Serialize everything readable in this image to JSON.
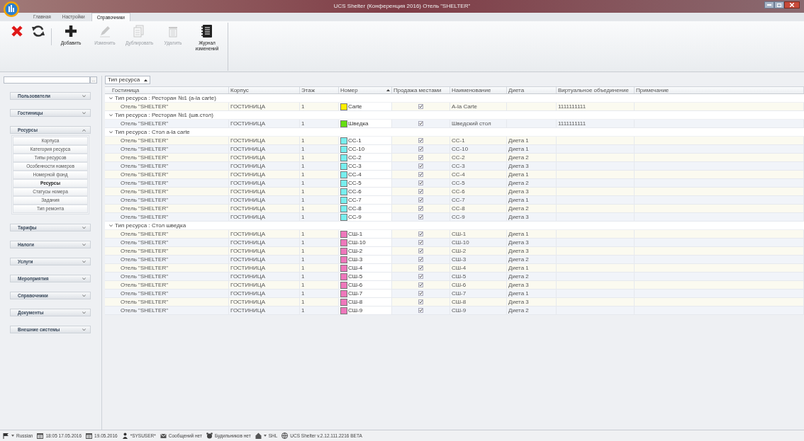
{
  "window": {
    "title": "UCS Shelter (Конференция 2016) Отель \"SHELTER\""
  },
  "tabs": [
    {
      "label": "Главная",
      "selected": false
    },
    {
      "label": "Настройки",
      "selected": false
    },
    {
      "label": "Справочники",
      "selected": true
    }
  ],
  "toolbar": [
    {
      "kind": "close",
      "disabled": false
    },
    {
      "kind": "refresh",
      "disabled": false
    },
    {
      "kind": "add",
      "label": "Добавить",
      "disabled": false
    },
    {
      "kind": "edit",
      "label": "Изменить",
      "disabled": true
    },
    {
      "kind": "duplicate",
      "label": "Дублировать",
      "disabled": true
    },
    {
      "kind": "delete",
      "label": "Удалить",
      "disabled": true
    },
    {
      "kind": "journal",
      "label": "Журнал изменений",
      "disabled": false
    }
  ],
  "sidebar": {
    "search_button": "...",
    "sections": [
      {
        "label": "Пользователи",
        "expanded": false
      },
      {
        "label": "Гостиницы",
        "expanded": false
      },
      {
        "label": "Ресурсы",
        "expanded": true,
        "items": [
          {
            "label": "Корпуса",
            "selected": false
          },
          {
            "label": "Категория ресурса",
            "selected": false
          },
          {
            "label": "Типы ресурсов",
            "selected": false
          },
          {
            "label": "Особенности номеров",
            "selected": false
          },
          {
            "label": "Номерной фонд",
            "selected": false
          },
          {
            "label": "Ресурсы",
            "selected": true
          },
          {
            "label": "Статусы номера",
            "selected": false
          },
          {
            "label": "Задания",
            "selected": false
          },
          {
            "label": "Тип ремонта",
            "selected": false
          }
        ]
      },
      {
        "label": "Тарифы",
        "expanded": false
      },
      {
        "label": "Налоги",
        "expanded": false
      },
      {
        "label": "Услуги",
        "expanded": false
      },
      {
        "label": "Мероприятия",
        "expanded": false
      },
      {
        "label": "Справочники",
        "expanded": false
      },
      {
        "label": "Документы",
        "expanded": false
      },
      {
        "label": "Внешние системы",
        "expanded": false
      }
    ]
  },
  "grouping": {
    "label": "Тип ресурса"
  },
  "table": {
    "columns": [
      {
        "label": "Гостиница",
        "sorted": false
      },
      {
        "label": "Корпус",
        "sorted": false
      },
      {
        "label": "Этаж",
        "sorted": false
      },
      {
        "label": "Номер",
        "sorted": true
      },
      {
        "label": "Продажа местами",
        "sorted": false
      },
      {
        "label": "Наименование",
        "sorted": false
      },
      {
        "label": "Диета",
        "sorted": false
      },
      {
        "label": "Виртуальное объединение",
        "sorted": false
      },
      {
        "label": "Примечание",
        "sorted": false
      }
    ],
    "groups": [
      {
        "label": "Тип ресурса : Ресторан №1 (a-la carte)",
        "expanded": true,
        "rows": [
          {
            "hotel": "Отель \"SHELTER\"",
            "building": "ГОСТИНИЦА",
            "floor": "1",
            "number": "Carte",
            "color": "#ffee00",
            "sale_by_seats": true,
            "name": "A-la Carte",
            "virtual_union": "1111111111"
          }
        ]
      },
      {
        "label": "Тип ресурса : Ресторан №1 (шв.стол)",
        "expanded": true,
        "rows": [
          {
            "hotel": "Отель \"SHELTER\"",
            "building": "ГОСТИНИЦА",
            "floor": "1",
            "number": "Шведка",
            "color": "#66dd11",
            "sale_by_seats": true,
            "name": "Шведский стол",
            "virtual_union": "1111111111"
          }
        ]
      },
      {
        "label": "Тип ресурса : Стол a-la carte",
        "expanded": true,
        "rows": [
          {
            "hotel": "Отель \"SHELTER\"",
            "building": "ГОСТИНИЦА",
            "floor": "1",
            "number": "CC-1",
            "color": "#77eeee",
            "sale_by_seats": true,
            "name": "CC-1",
            "diet": "Диета 1"
          },
          {
            "hotel": "Отель \"SHELTER\"",
            "building": "ГОСТИНИЦА",
            "floor": "1",
            "number": "CC-10",
            "color": "#77eeee",
            "sale_by_seats": true,
            "name": "CC-10",
            "diet": "Диета 1"
          },
          {
            "hotel": "Отель \"SHELTER\"",
            "building": "ГОСТИНИЦА",
            "floor": "1",
            "number": "CC-2",
            "color": "#77eeee",
            "sale_by_seats": true,
            "name": "CC-2",
            "diet": "Диета 2"
          },
          {
            "hotel": "Отель \"SHELTER\"",
            "building": "ГОСТИНИЦА",
            "floor": "1",
            "number": "CC-3",
            "color": "#77eeee",
            "sale_by_seats": true,
            "name": "CC-3",
            "diet": "Диета 3"
          },
          {
            "hotel": "Отель \"SHELTER\"",
            "building": "ГОСТИНИЦА",
            "floor": "1",
            "number": "CC-4",
            "color": "#77eeee",
            "sale_by_seats": true,
            "name": "CC-4",
            "diet": "Диета 1"
          },
          {
            "hotel": "Отель \"SHELTER\"",
            "building": "ГОСТИНИЦА",
            "floor": "1",
            "number": "CC-5",
            "color": "#77eeee",
            "sale_by_seats": true,
            "name": "CC-5",
            "diet": "Диета 2"
          },
          {
            "hotel": "Отель \"SHELTER\"",
            "building": "ГОСТИНИЦА",
            "floor": "1",
            "number": "CC-6",
            "color": "#77eeee",
            "sale_by_seats": true,
            "name": "CC-6",
            "diet": "Диета 3"
          },
          {
            "hotel": "Отель \"SHELTER\"",
            "building": "ГОСТИНИЦА",
            "floor": "1",
            "number": "CC-7",
            "color": "#77eeee",
            "sale_by_seats": true,
            "name": "CC-7",
            "diet": "Диета 1"
          },
          {
            "hotel": "Отель \"SHELTER\"",
            "building": "ГОСТИНИЦА",
            "floor": "1",
            "number": "CC-8",
            "color": "#77eeee",
            "sale_by_seats": true,
            "name": "CC-8",
            "diet": "Диета 2"
          },
          {
            "hotel": "Отель \"SHELTER\"",
            "building": "ГОСТИНИЦА",
            "floor": "1",
            "number": "CC-9",
            "color": "#77eeee",
            "sale_by_seats": true,
            "name": "CC-9",
            "diet": "Диета 3"
          }
        ]
      },
      {
        "label": "Тип ресурса : Стол шведка",
        "expanded": true,
        "rows": [
          {
            "hotel": "Отель \"SHELTER\"",
            "building": "ГОСТИНИЦА",
            "floor": "1",
            "number": "СШ-1",
            "color": "#ee77bb",
            "sale_by_seats": true,
            "name": "СШ-1",
            "diet": "Диета 1"
          },
          {
            "hotel": "Отель \"SHELTER\"",
            "building": "ГОСТИНИЦА",
            "floor": "1",
            "number": "СШ-10",
            "color": "#ee77bb",
            "sale_by_seats": true,
            "name": "СШ-10",
            "diet": "Диета 3"
          },
          {
            "hotel": "Отель \"SHELTER\"",
            "building": "ГОСТИНИЦА",
            "floor": "1",
            "number": "СШ-2",
            "color": "#ee77bb",
            "sale_by_seats": true,
            "name": "СШ-2",
            "diet": "Диета 3"
          },
          {
            "hotel": "Отель \"SHELTER\"",
            "building": "ГОСТИНИЦА",
            "floor": "1",
            "number": "СШ-3",
            "color": "#ee77bb",
            "sale_by_seats": true,
            "name": "СШ-3",
            "diet": "Диета 2"
          },
          {
            "hotel": "Отель \"SHELTER\"",
            "building": "ГОСТИНИЦА",
            "floor": "1",
            "number": "СШ-4",
            "color": "#ee77bb",
            "sale_by_seats": true,
            "name": "СШ-4",
            "diet": "Диета 1"
          },
          {
            "hotel": "Отель \"SHELTER\"",
            "building": "ГОСТИНИЦА",
            "floor": "1",
            "number": "СШ-5",
            "color": "#ee77bb",
            "sale_by_seats": true,
            "name": "СШ-5",
            "diet": "Диета 2"
          },
          {
            "hotel": "Отель \"SHELTER\"",
            "building": "ГОСТИНИЦА",
            "floor": "1",
            "number": "СШ-6",
            "color": "#ee77bb",
            "sale_by_seats": true,
            "name": "СШ-6",
            "diet": "Диета 3"
          },
          {
            "hotel": "Отель \"SHELTER\"",
            "building": "ГОСТИНИЦА",
            "floor": "1",
            "number": "СШ-7",
            "color": "#ee77bb",
            "sale_by_seats": true,
            "name": "СШ-7",
            "diet": "Диета 1"
          },
          {
            "hotel": "Отель \"SHELTER\"",
            "building": "ГОСТИНИЦА",
            "floor": "1",
            "number": "СШ-8",
            "color": "#ee77bb",
            "sale_by_seats": true,
            "name": "СШ-8",
            "diet": "Диета 3"
          },
          {
            "hotel": "Отель \"SHELTER\"",
            "building": "ГОСТИНИЦА",
            "floor": "1",
            "number": "СШ-9",
            "color": "#ee77bb",
            "sale_by_seats": true,
            "name": "СШ-9",
            "diet": "Диета 2"
          }
        ]
      }
    ]
  },
  "status_bar": [
    {
      "kind": "flag",
      "caret": true,
      "text": "Russian"
    },
    {
      "kind": "calendar",
      "text": "18:05 17.05.2016"
    },
    {
      "kind": "calendar",
      "text": "19.05.2016"
    },
    {
      "kind": "user",
      "text": "*SYSUSER*"
    },
    {
      "kind": "mail",
      "text": "Сообщений нет"
    },
    {
      "kind": "alarm",
      "text": "Будильников нет"
    },
    {
      "kind": "home",
      "caret": true,
      "text": "SHL"
    },
    {
      "kind": "globe",
      "text": "UCS Shelter v.2.12.111.2216 BETA"
    }
  ]
}
